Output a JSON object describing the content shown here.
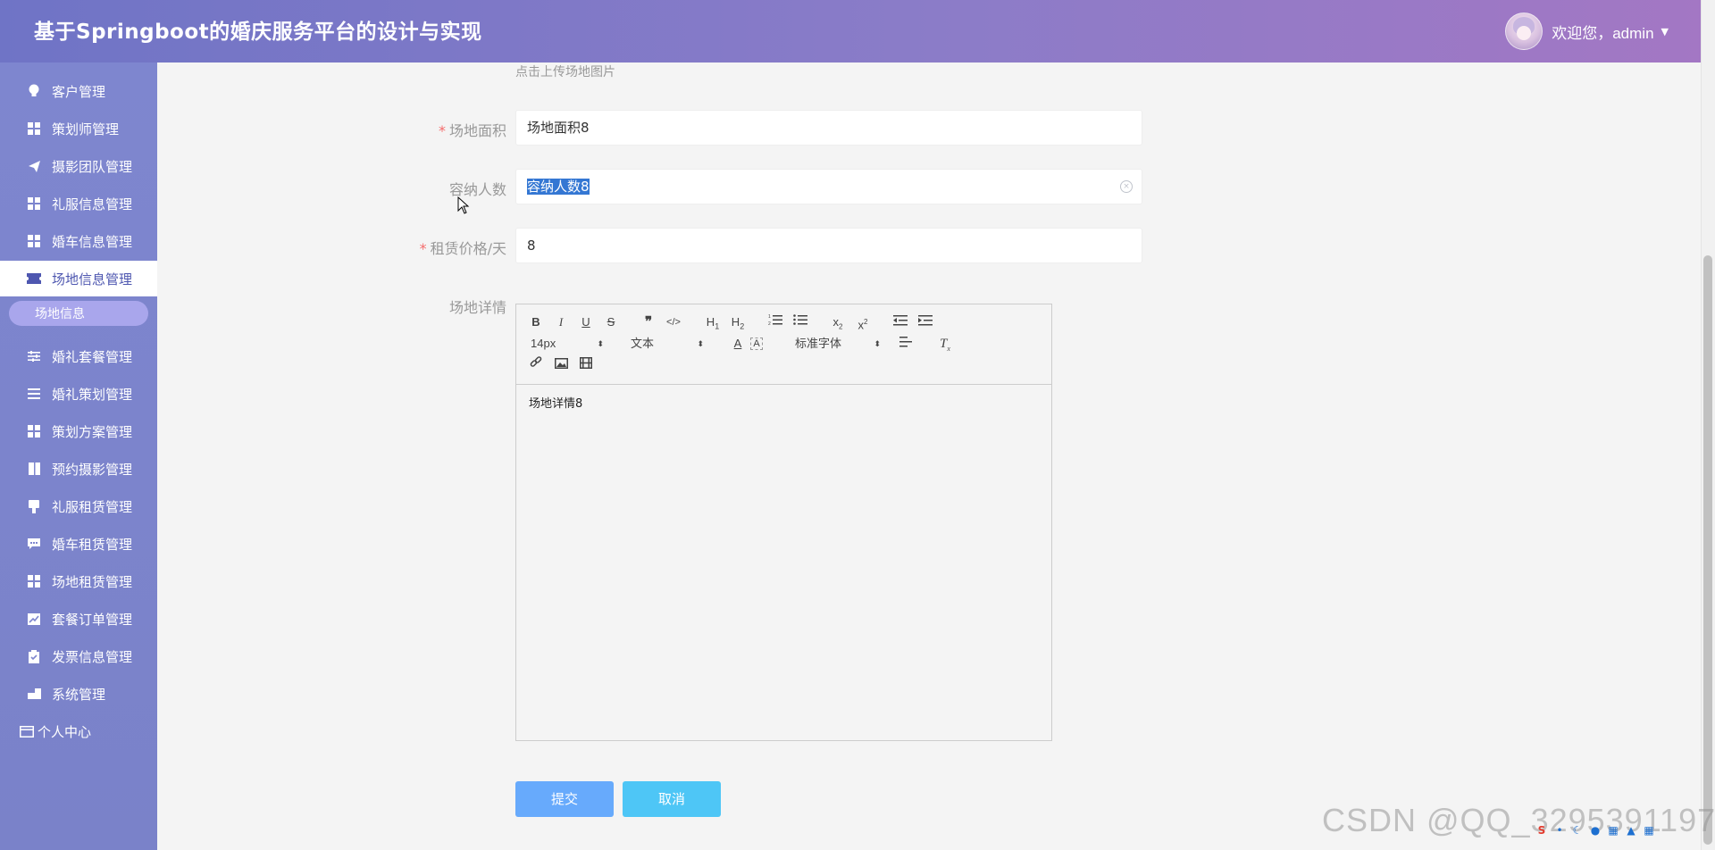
{
  "header": {
    "title": "基于Springboot的婚庆服务平台的设计与实现",
    "welcome": "欢迎您，admin"
  },
  "sidebar": {
    "items": [
      {
        "label": "客户管理",
        "icon": "bulb-icon"
      },
      {
        "label": "策划师管理",
        "icon": "grid-icon"
      },
      {
        "label": "摄影团队管理",
        "icon": "send-icon"
      },
      {
        "label": "礼服信息管理",
        "icon": "grid-icon"
      },
      {
        "label": "婚车信息管理",
        "icon": "grid-icon"
      },
      {
        "label": "场地信息管理",
        "icon": "ticket-icon",
        "active": true
      },
      {
        "label": "婚礼套餐管理",
        "icon": "sliders-icon"
      },
      {
        "label": "婚礼策划管理",
        "icon": "list-icon"
      },
      {
        "label": "策划方案管理",
        "icon": "grid-icon"
      },
      {
        "label": "预约摄影管理",
        "icon": "book-icon"
      },
      {
        "label": "礼服租赁管理",
        "icon": "phone-icon"
      },
      {
        "label": "婚车租赁管理",
        "icon": "chat-icon"
      },
      {
        "label": "场地租赁管理",
        "icon": "grid-icon"
      },
      {
        "label": "套餐订单管理",
        "icon": "chart-icon"
      },
      {
        "label": "发票信息管理",
        "icon": "clipboard-icon"
      },
      {
        "label": "系统管理",
        "icon": "mail-icon"
      },
      {
        "label": "个人中心",
        "icon": "card-icon"
      }
    ],
    "sub_active": "场地信息"
  },
  "form": {
    "upload_hint": "点击上传场地图片",
    "area": {
      "label": "场地面积",
      "value": "场地面积8",
      "required": true
    },
    "capacity": {
      "label": "容纳人数",
      "value": "容纳人数8",
      "required": false
    },
    "price": {
      "label": "租赁价格/天",
      "value": "8",
      "required": true
    },
    "detail": {
      "label": "场地详情",
      "content": "场地详情8"
    }
  },
  "editor_toolbar": {
    "font_size": "14px",
    "header": "文本",
    "font_family": "标准字体"
  },
  "actions": {
    "submit": "提交",
    "cancel": "取消"
  },
  "watermark": "CSDN @QQ_3295391197"
}
